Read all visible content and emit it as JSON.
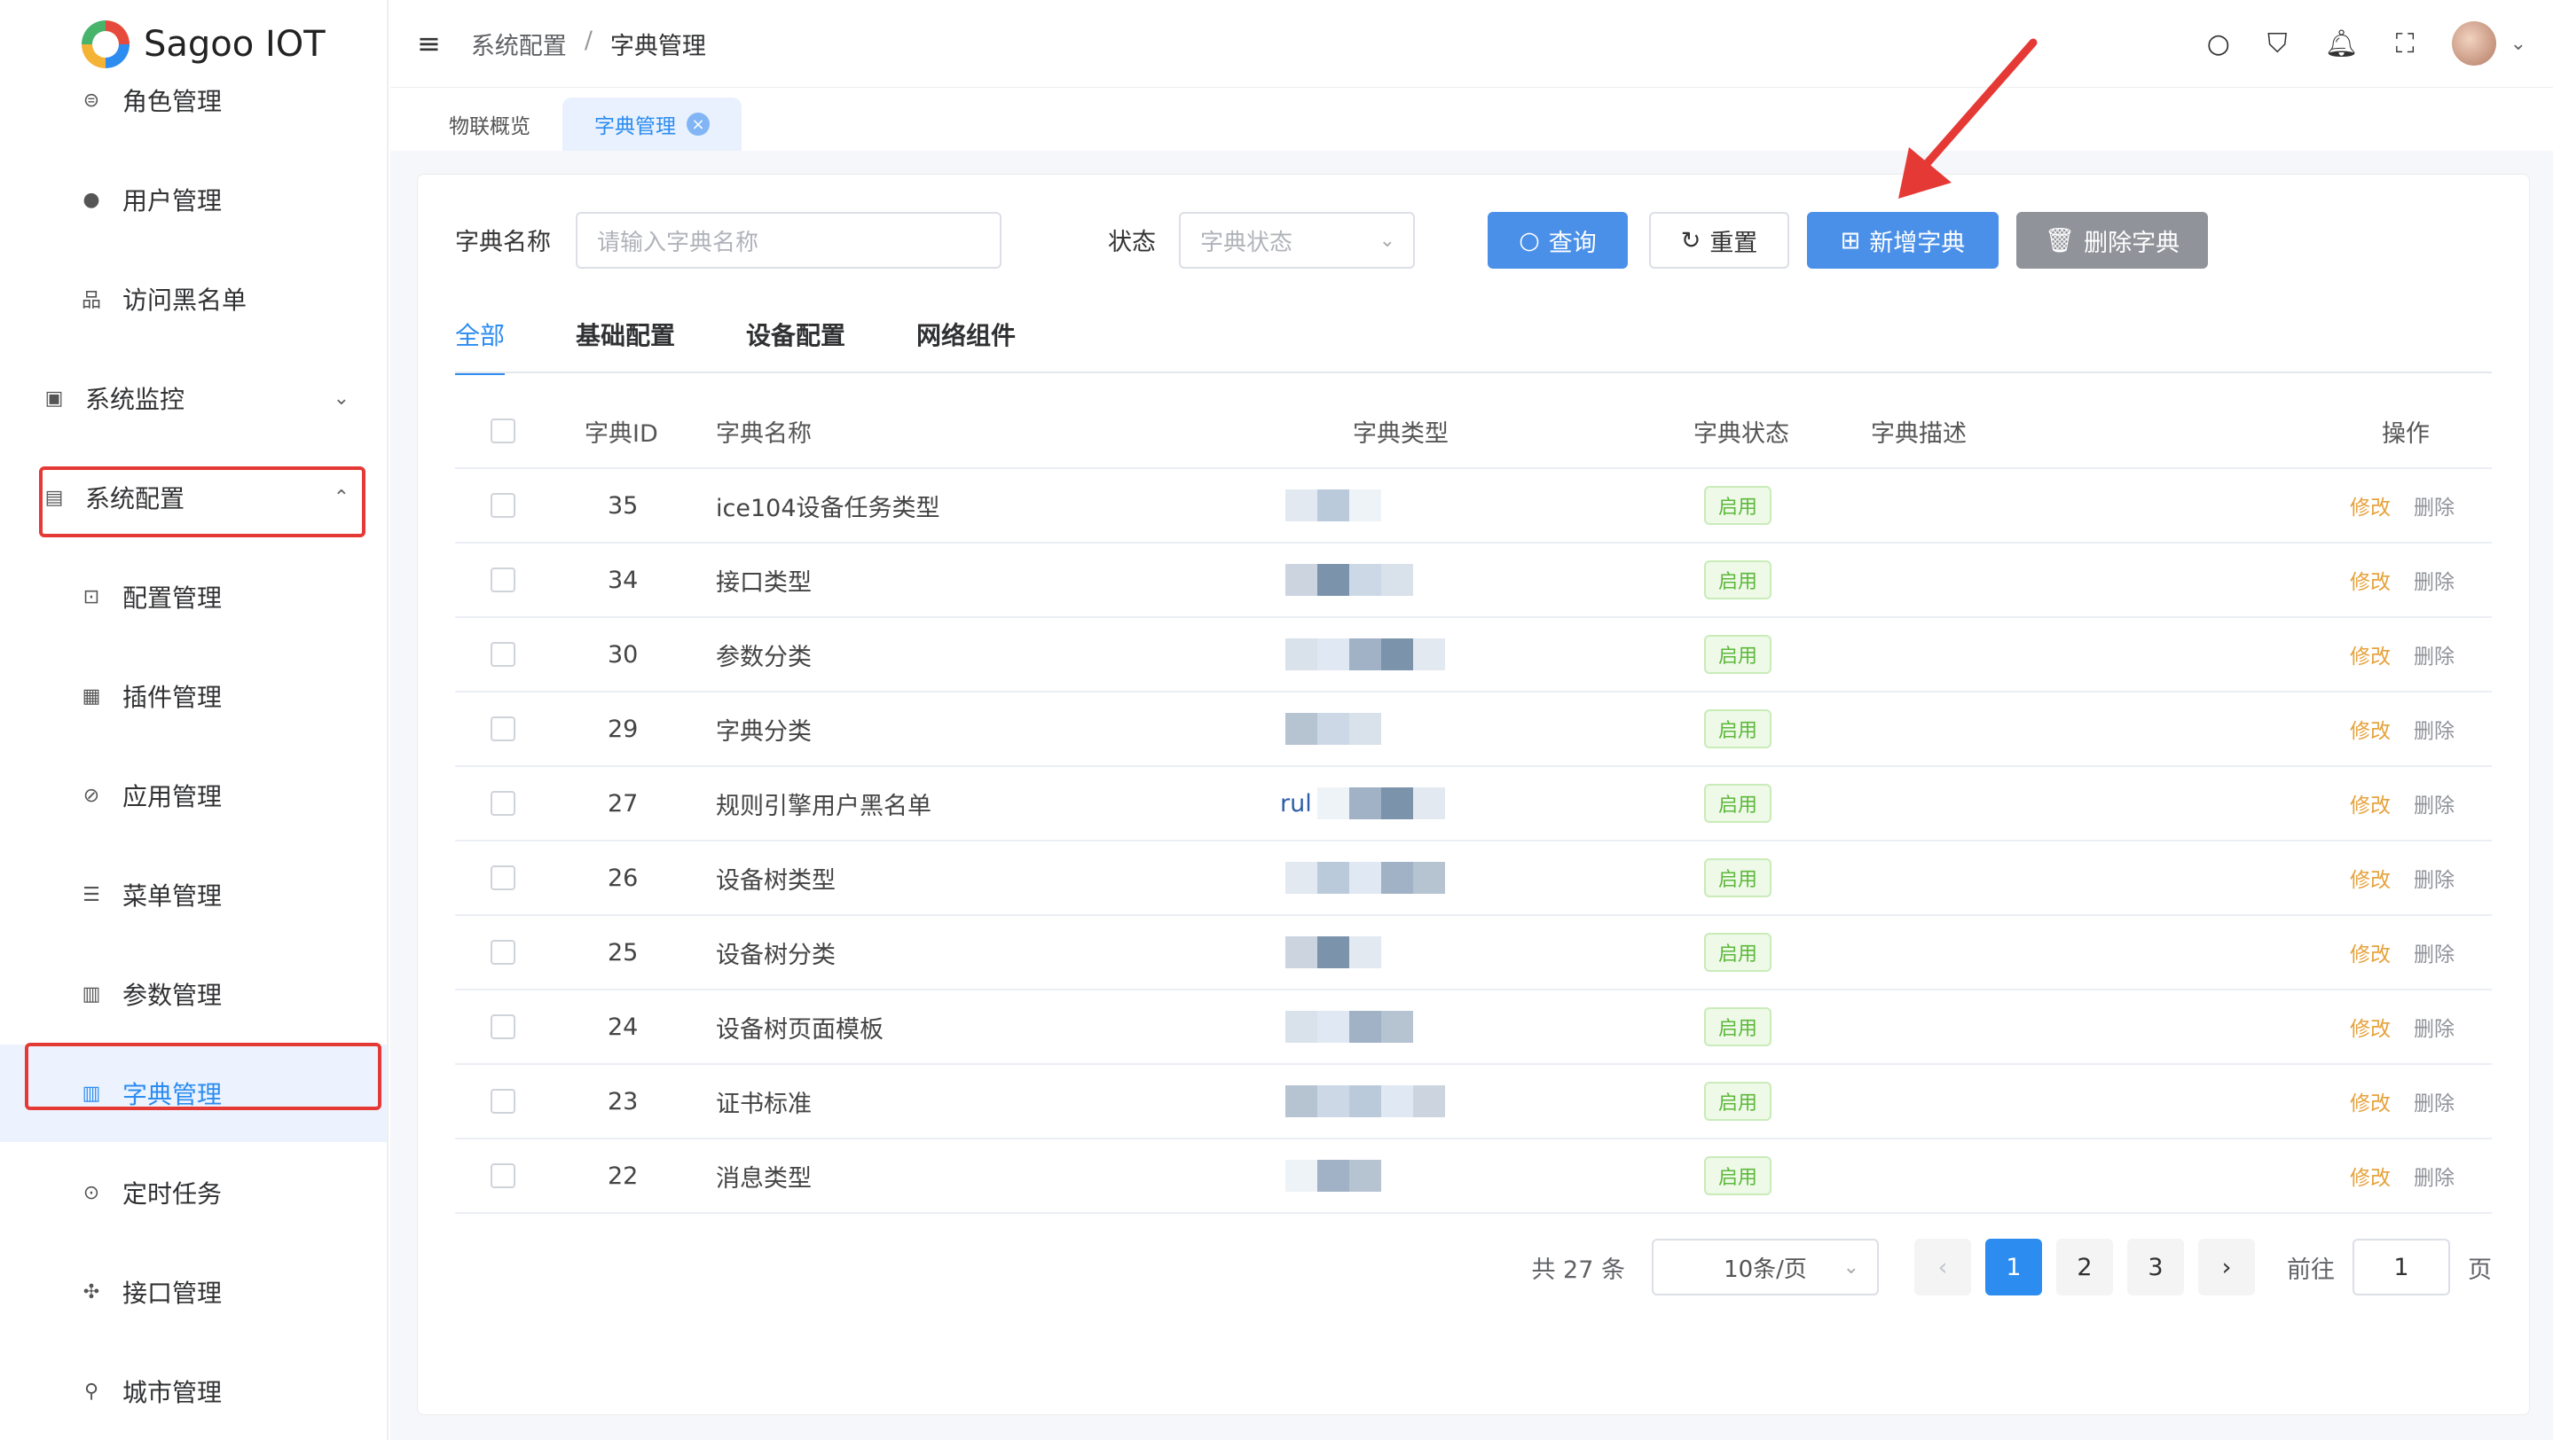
{
  "app": {
    "title": "Sagoo IOT"
  },
  "sidebar": {
    "items": [
      {
        "label": "角色管理",
        "icon": "role-icon"
      },
      {
        "label": "用户管理",
        "icon": "user-icon"
      },
      {
        "label": "访问黑名单",
        "icon": "org-icon"
      },
      {
        "label": "系统监控",
        "icon": "monitor-icon"
      },
      {
        "label": "系统配置",
        "icon": "config-icon"
      },
      {
        "label": "配置管理",
        "icon": "config-manage-icon"
      },
      {
        "label": "插件管理",
        "icon": "plugin-icon"
      },
      {
        "label": "应用管理",
        "icon": "app-icon"
      },
      {
        "label": "菜单管理",
        "icon": "menu-icon"
      },
      {
        "label": "参数管理",
        "icon": "param-icon"
      },
      {
        "label": "字典管理",
        "icon": "dict-icon"
      },
      {
        "label": "定时任务",
        "icon": "timer-icon"
      },
      {
        "label": "接口管理",
        "icon": "api-icon"
      },
      {
        "label": "城市管理",
        "icon": "city-icon"
      }
    ]
  },
  "header": {
    "breadcrumb": [
      "系统配置",
      "字典管理"
    ],
    "separator": "/"
  },
  "page_tabs": [
    {
      "label": "物联概览"
    },
    {
      "label": "字典管理"
    }
  ],
  "filters": {
    "name_label": "字典名称",
    "name_placeholder": "请输入字典名称",
    "status_label": "状态",
    "status_placeholder": "字典状态",
    "query_button": "查询",
    "reset_button": "重置",
    "add_button": "新增字典",
    "delete_button": "删除字典"
  },
  "category_tabs": [
    "全部",
    "基础配置",
    "设备配置",
    "网络组件"
  ],
  "table": {
    "headers": {
      "id": "字典ID",
      "name": "字典名称",
      "type": "字典类型",
      "status": "字典状态",
      "desc": "字典描述",
      "ops": "操作"
    },
    "rows": [
      {
        "id": "35",
        "name": "ice104设备任务类型",
        "type": "",
        "status": "启用"
      },
      {
        "id": "34",
        "name": "接口类型",
        "type": "",
        "status": "启用"
      },
      {
        "id": "30",
        "name": "参数分类",
        "type": "",
        "status": "启用"
      },
      {
        "id": "29",
        "name": "字典分类",
        "type": "",
        "status": "启用"
      },
      {
        "id": "27",
        "name": "规则引擎用户黑名单",
        "type": "rul",
        "status": "启用"
      },
      {
        "id": "26",
        "name": "设备树类型",
        "type": "",
        "status": "启用"
      },
      {
        "id": "25",
        "name": "设备树分类",
        "type": "",
        "status": "启用"
      },
      {
        "id": "24",
        "name": "设备树页面模板",
        "type": "",
        "status": "启用"
      },
      {
        "id": "23",
        "name": "证书标准",
        "type": "",
        "status": "启用"
      },
      {
        "id": "22",
        "name": "消息类型",
        "type": "",
        "status": "启用"
      }
    ],
    "edit_label": "修改",
    "delete_label": "删除"
  },
  "pagination": {
    "total_text": "共 27 条",
    "page_size": "10条/页",
    "pages": [
      "1",
      "2",
      "3"
    ],
    "current": "1",
    "goto_label": "前往",
    "goto_value": "1",
    "goto_suffix": "页"
  },
  "colors": {
    "primary": "#2d8cf0",
    "highlight_box": "#e53935",
    "success": "#5cb83a",
    "warning": "#e6a23c"
  }
}
